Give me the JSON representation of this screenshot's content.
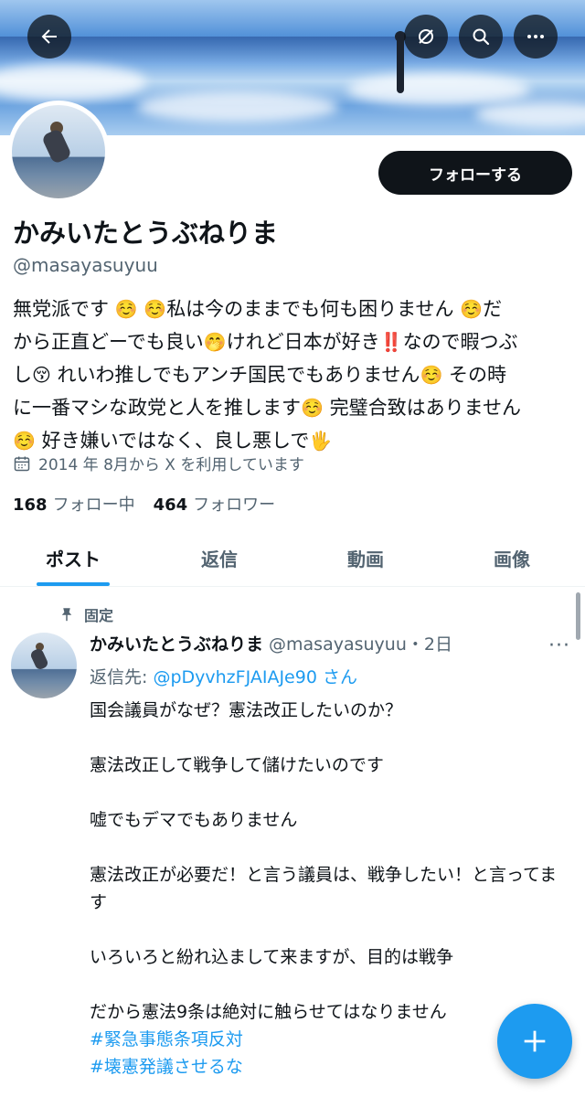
{
  "header": {
    "back_icon": "arrow-left-icon",
    "buttons": [
      "grok-icon",
      "search-icon",
      "more-icon"
    ]
  },
  "profile": {
    "follow_label": "フォローする",
    "name": "かみいたとうぶねりま",
    "handle": "@masayasuyuu",
    "bio_lines": [
      [
        "無党派です ",
        "☺️",
        " ",
        "☺️",
        "私は今のままでも何も困りません ",
        "☺️",
        "だ"
      ],
      [
        "から正直どーでも良い",
        "🤭",
        "けれど日本が好き",
        "‼️",
        "なので暇つぶ"
      ],
      [
        "し",
        "😚",
        " れいわ推しでもアンチ国民でもありません",
        "☺️",
        " その時"
      ],
      [
        "に一番マシな政党と人を推します",
        "☺️",
        " 完璧合致はありません"
      ],
      [
        "☺️",
        " 好き嫌いではなく、良し悪しで",
        "🖐"
      ]
    ],
    "joined": "2014 年 8月から X を利用しています",
    "following_count": "168",
    "following_label": "フォロー中",
    "followers_count": "464",
    "followers_label": "フォロワー"
  },
  "tabs": [
    "ポスト",
    "返信",
    "動画",
    "画像"
  ],
  "active_tab": 0,
  "pinned_tweet": {
    "pinned_label": "固定",
    "name": "かみいたとうぶねりま",
    "meta": "@masayasuyuu・2日",
    "reply_prefix": "返信先: ",
    "reply_handle": "@pDyvhzFJAIAJe90",
    "reply_suffix": " さん",
    "paragraphs": [
      "国会議員がなぜ？憲法改正したいのか？",
      "憲法改正して戦争して儲けたいのです",
      "嘘でもデマでもありません",
      "憲法改正が必要だ！と言う議員は、戦争したい！と言ってます",
      "いろいろと紛れ込まして来ますが、目的は戦争",
      "だから憲法9条は絶対に触らせてはなりません"
    ],
    "hashtags": [
      "#緊急事態条項反対",
      "#壊憲発議させるな"
    ]
  },
  "fab_icon": "plus-icon",
  "colors": {
    "accent": "#1d9bf0",
    "text": "#0f1419",
    "secondary": "#536471"
  }
}
